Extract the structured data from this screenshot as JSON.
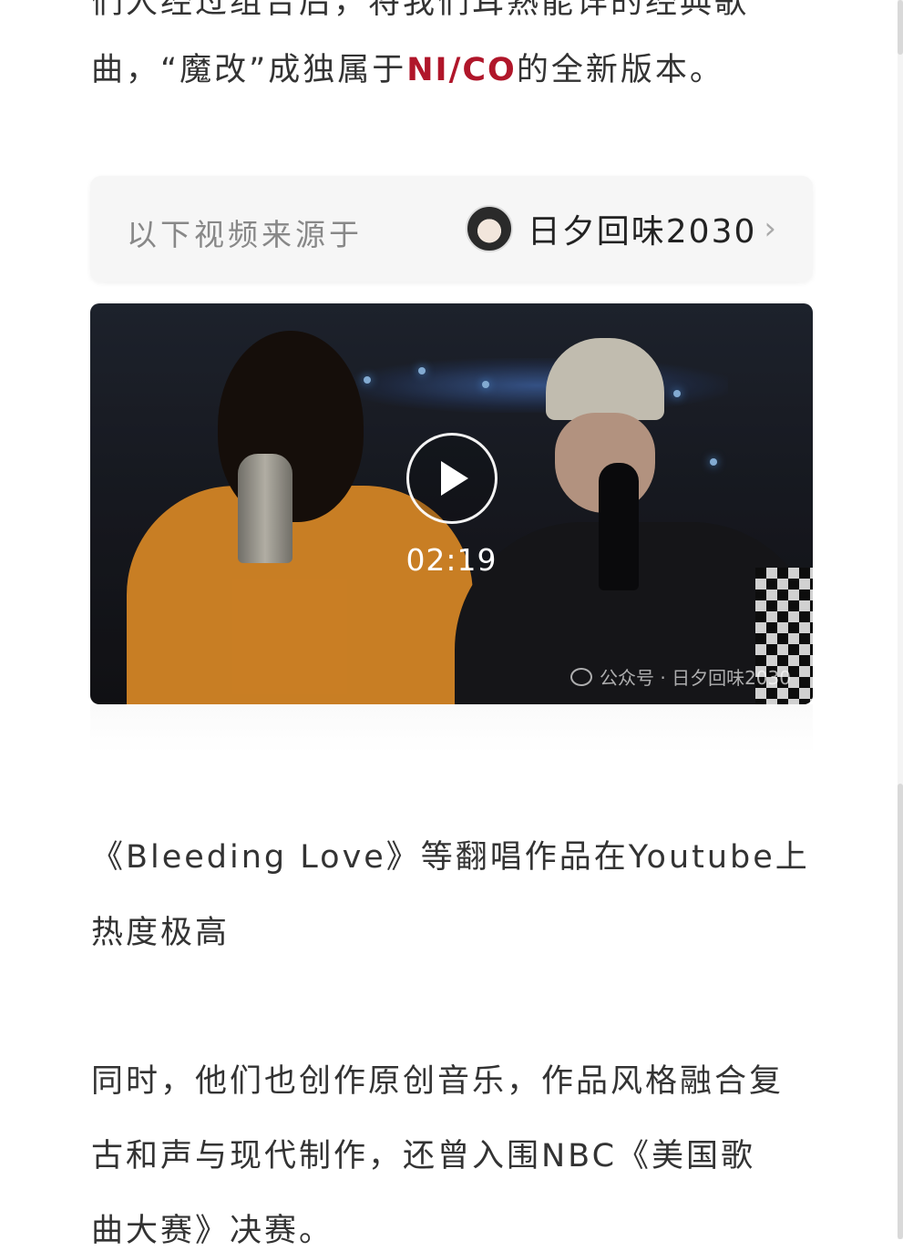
{
  "article": {
    "top_cut_line": "们人经过组合后，将我们耳熟能详的经典歌",
    "line1_before": "曲，“魔改”成独属于",
    "line1_brand": "NI/CO",
    "line1_after": "的全新版本。",
    "para2_line1": "《Bleeding Love》等翻唱作品在Youtube上",
    "para2_line2": "热度极高",
    "para3_line1": "同时，他们也创作原创音乐，作品风格融合复",
    "para3_line2": "古和声与现代制作，还曾入围NBC《美国歌",
    "para3_line3": "曲大赛》决赛。"
  },
  "source_card": {
    "label": "以下视频来源于",
    "account_name": "日夕回味2030",
    "chevron": "›"
  },
  "video": {
    "duration": "02:19",
    "watermark": "公众号 · 日夕回味2030"
  },
  "colors": {
    "brand": "#b0162a",
    "text": "#333333",
    "muted": "#888888"
  },
  "icons": {
    "play": "play-icon",
    "chevron": "chevron-right-icon",
    "wechat": "wechat-icon"
  }
}
